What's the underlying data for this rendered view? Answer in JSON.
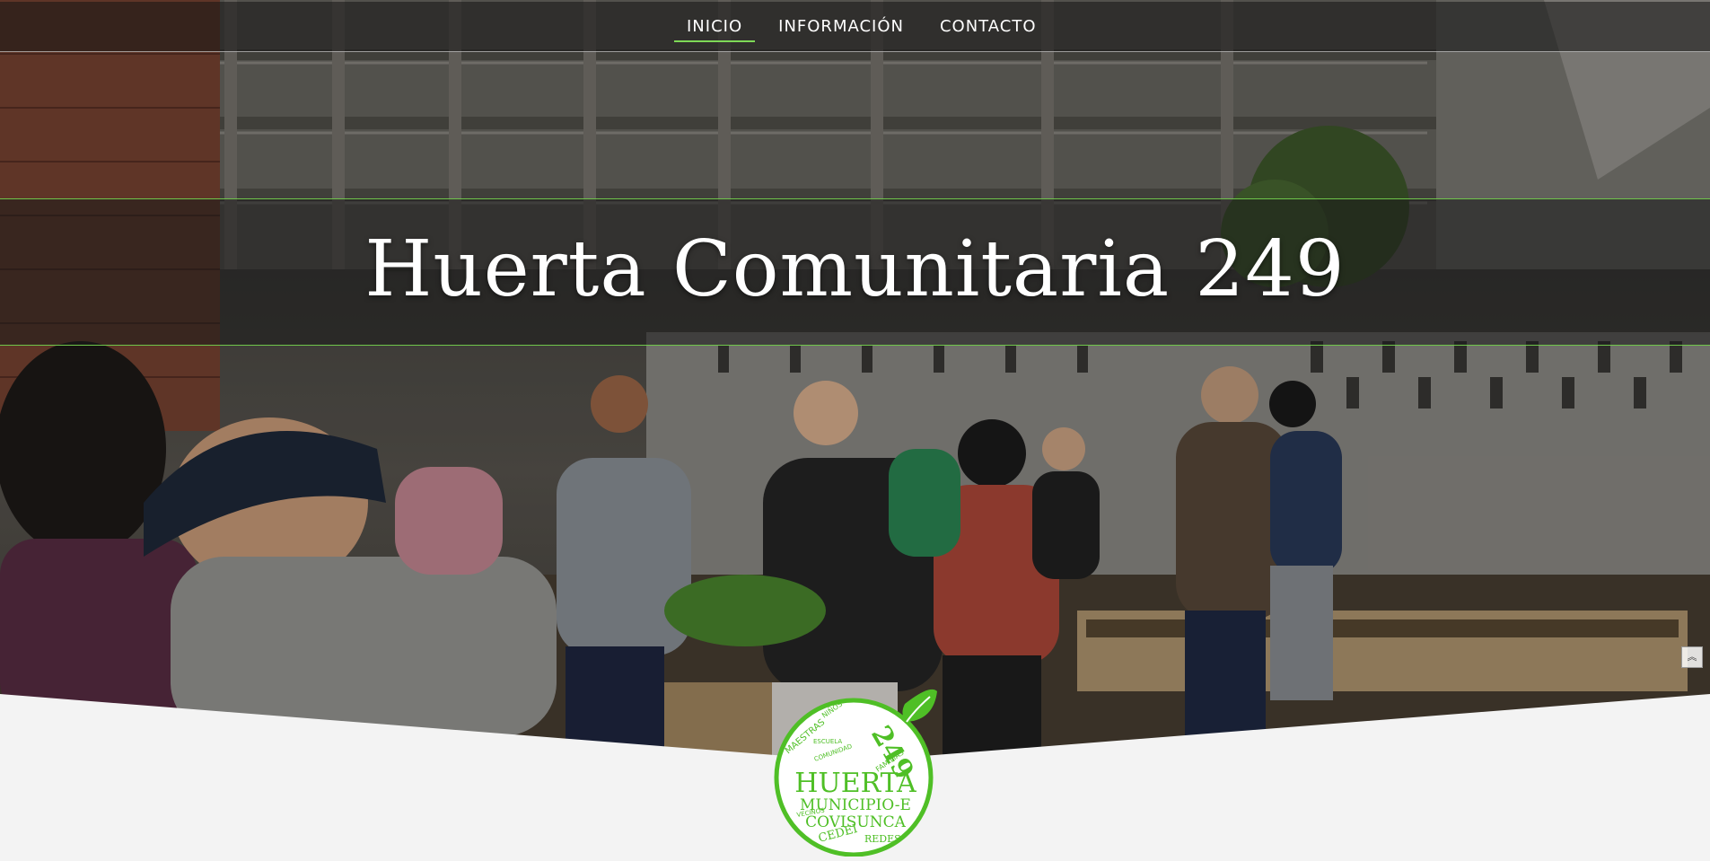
{
  "nav": {
    "items": [
      {
        "label": "INICIO",
        "active": true
      },
      {
        "label": "INFORMACIÓN",
        "active": false
      },
      {
        "label": "CONTACTO",
        "active": false
      }
    ]
  },
  "hero": {
    "title": "Huerta Comunitaria 249"
  },
  "logo": {
    "number": "249",
    "main_word": "HUERTA",
    "line_1": "MUNICIPIO-E",
    "line_2": "COVISUNCA",
    "line_3": "CEDEI",
    "line_4": "REDES",
    "small_words": [
      "NIÑOS",
      "MAESTRAS",
      "FAMILIAS",
      "ESCUELA",
      "COMUNIDAD",
      "HUERTA",
      "VECINOS"
    ],
    "icon": "leaf-icon"
  },
  "scroll_button": {
    "icon": "double-chevron-up-icon"
  },
  "colors": {
    "accent": "#7ed957",
    "logo_green": "#4fbf26",
    "navbar_bg": "#141414",
    "page_bg": "#f3f3f3",
    "text_white": "#ffffff"
  }
}
